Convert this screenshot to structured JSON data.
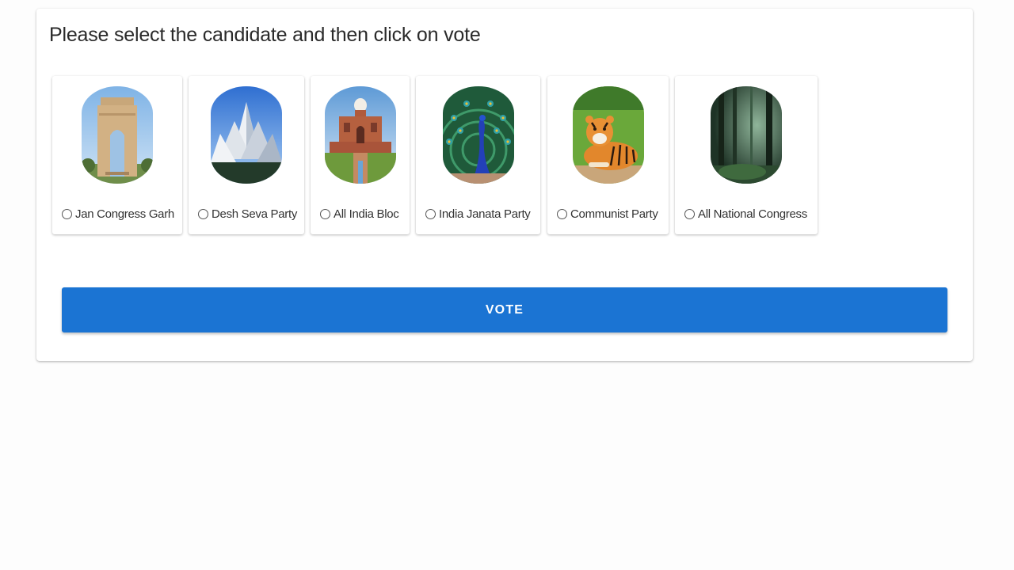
{
  "form": {
    "heading": "Please select the candidate and then click on vote",
    "vote_label": "VOTE"
  },
  "candidates": [
    {
      "label": "Jan Congress Garh",
      "icon": "india-gate-icon"
    },
    {
      "label": "Desh Seva Party",
      "icon": "lotus-temple-icon"
    },
    {
      "label": "All India Bloc",
      "icon": "humayun-tomb-icon"
    },
    {
      "label": "India Janata Party",
      "icon": "peacock-icon"
    },
    {
      "label": "Communist Party",
      "icon": "tiger-icon"
    },
    {
      "label": "All National Congress",
      "icon": "forest-icon"
    }
  ],
  "colors": {
    "primary": "#1b74d3",
    "card_background": "#ffffff",
    "page_background": "#fdfdfd"
  }
}
